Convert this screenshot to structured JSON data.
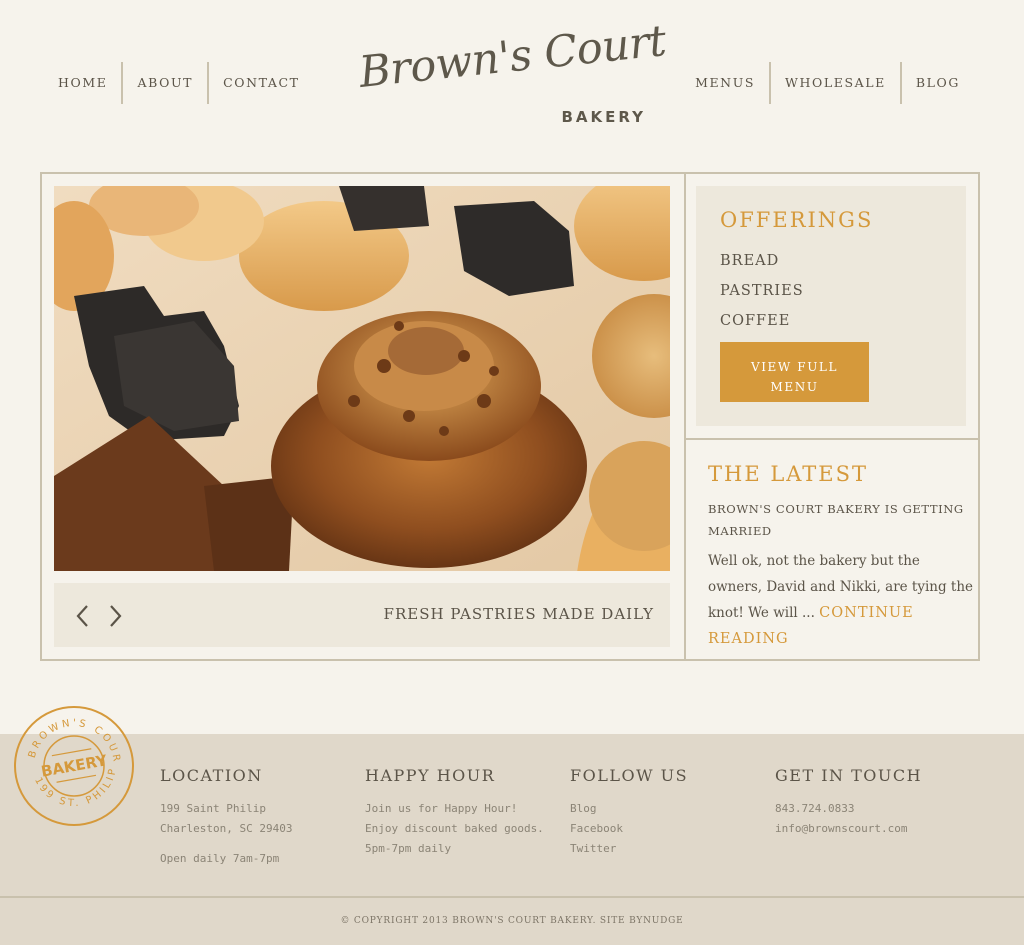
{
  "nav_left": [
    "HOME",
    "ABOUT",
    "CONTACT"
  ],
  "nav_right": [
    "MENUS",
    "WHOLESALE",
    "BLOG"
  ],
  "logo": {
    "script": "Brown's Court",
    "sub": "BAKERY"
  },
  "slider": {
    "caption": "FRESH PASTRIES MADE DAILY",
    "image": "pastries-photo"
  },
  "offerings": {
    "title": "OFFERINGS",
    "items": [
      "BREAD",
      "PASTRIES",
      "COFFEE"
    ],
    "button_line1": "VIEW FULL",
    "button_line2": "MENU"
  },
  "latest": {
    "title": "THE LATEST",
    "post_title": "BROWN'S COURT BAKERY IS GETTING MARRIED",
    "excerpt": "Well ok, not the bakery but the owners, David and Nikki, are tying the knot! We will ... ",
    "more": "CONTINUE READING"
  },
  "stamp": {
    "top": "BROWN'S COURT",
    "center": "BAKERY",
    "bottom": "199 ST. PHILIP"
  },
  "footer": {
    "location": {
      "title": "LOCATION",
      "line1": "199 Saint Philip",
      "line2": "Charleston, SC 29403",
      "line3": "Open daily 7am-7pm"
    },
    "happy_hour": {
      "title": "HAPPY HOUR",
      "line1": "Join us for Happy Hour!",
      "line2": "Enjoy discount baked goods.",
      "line3": "5pm-7pm daily"
    },
    "follow": {
      "title": "FOLLOW US",
      "links": [
        "Blog",
        "Facebook",
        "Twitter"
      ]
    },
    "contact": {
      "title": "GET IN TOUCH",
      "phone": "843.724.0833",
      "email": "info@brownscourt.com"
    },
    "copyright": "© COPYRIGHT 2013 BROWN'S COURT BAKERY. SITE BYNUDGE"
  },
  "colors": {
    "accent": "#d5993b",
    "background": "#f6f3ec",
    "panel": "#ede8dc",
    "footer": "#e0d8ca",
    "text": "#5b5448"
  }
}
